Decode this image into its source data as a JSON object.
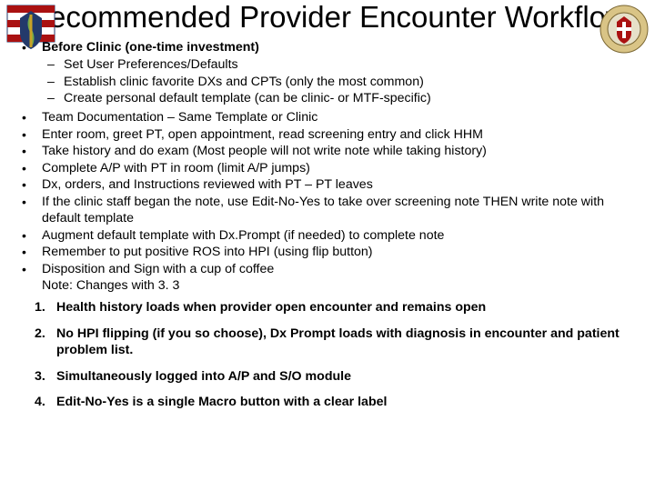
{
  "title": "Recommended Provider Encounter Workflow",
  "bullets": {
    "b0": {
      "head": "Before Clinic (one-time investment)"
    },
    "sub": {
      "s0": "Set User Preferences/Defaults",
      "s1": "Establish clinic favorite DXs and CPTs (only the most common)",
      "s2": "Create personal default template (can be clinic- or MTF-specific)"
    },
    "b1": "Team Documentation – Same Template or Clinic",
    "b2": "Enter room, greet PT, open appointment, read screening entry and click HHM",
    "b3": "Take history and do exam (Most people will not write note while taking history)",
    "b4": "Complete A/P with PT in room (limit A/P jumps)",
    "b5": "Dx, orders, and Instructions reviewed with PT – PT leaves",
    "b6": "If the clinic staff began the note, use Edit-No-Yes to take over screening note THEN write note with default template",
    "b7": "Augment default template with Dx.Prompt (if needed) to complete note",
    "b8": "Remember to put positive ROS into HPI (using flip button)",
    "b9": "Disposition and Sign with a cup of coffee"
  },
  "note": "Note: Changes with 3. 3",
  "numbered": {
    "n1": "Health history loads when provider open encounter and remains open",
    "n2": "No HPI flipping (if you so choose), Dx Prompt loads with diagnosis in encounter and patient problem list.",
    "n3": "Simultaneously logged into A/P and S/O module",
    "n4": "Edit-No-Yes is a single Macro button with a clear label"
  }
}
